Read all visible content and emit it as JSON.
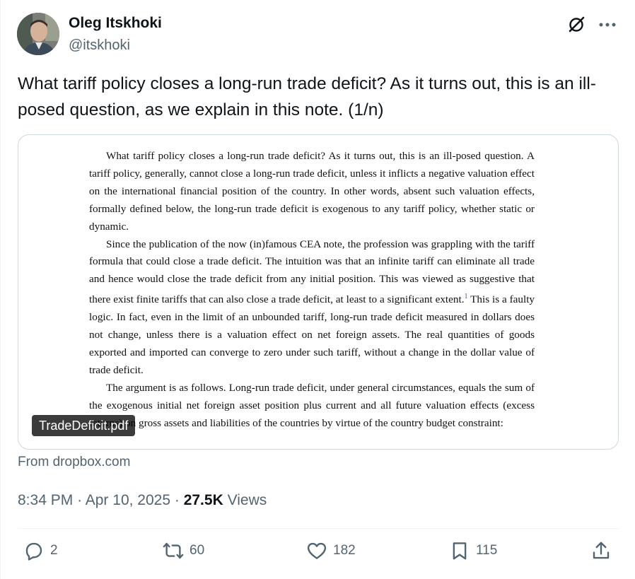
{
  "author": {
    "name": "Oleg Itskhoki",
    "handle": "@itskhoki"
  },
  "tweet": {
    "text": "What tariff policy closes a long-run trade deficit? As it turns out, this is an ill-posed question, as we explain in this note. (1/n)"
  },
  "attachment": {
    "paragraphs": [
      "What tariff policy closes a long-run trade deficit? As it turns out, this is an ill-posed question. A tariff policy, generally, cannot close a long-run trade deficit, unless it inflicts a negative valuation effect on the international financial position of the country. In other words, absent such valuation effects, formally defined below, the long-run trade deficit is exogenous to any tariff policy, whether static or dynamic.",
      "Since the publication of the now (in)famous CEA note, the profession was grappling with the tariff formula that could close a trade deficit. The intuition was that an infinite tariff can eliminate all trade and hence would close the trade deficit from any initial position. This was viewed as suggestive that there exist finite tariffs that can also close a trade deficit, at least to a significant extent.",
      "This is a faulty logic. In fact, even in the limit of an unbounded tariff, long-run trade deficit measured in dollars does not change, unless there is a valuation effect on net foreign assets. The real quantities of goods exported and imported can converge to zero under such tariff, without a change in the dollar value of trade deficit.",
      "The argument is as follows. Long-run trade deficit, under general circumstances, equals the sum of the exogenous initial net foreign asset position plus current and all future valuation effects (excess returns) on gross assets and liabilities of the countries by virtue of the country budget constraint:"
    ],
    "footnote_mark": "1",
    "filename": "TradeDeficit.pdf",
    "source": "From dropbox.com"
  },
  "meta": {
    "time": "8:34 PM",
    "date": "Apr 10, 2025",
    "sep": "·",
    "views_count": "27.5K",
    "views_label": "Views"
  },
  "actions": {
    "replies": "2",
    "reposts": "60",
    "likes": "182",
    "bookmarks": "115"
  },
  "icons": [
    "grok-icon",
    "more-icon",
    "reply-icon",
    "repost-icon",
    "like-icon",
    "bookmark-icon",
    "share-icon"
  ],
  "colors": {
    "text": "#0f1419",
    "secondary": "#536471",
    "border": "#cfd9de"
  }
}
